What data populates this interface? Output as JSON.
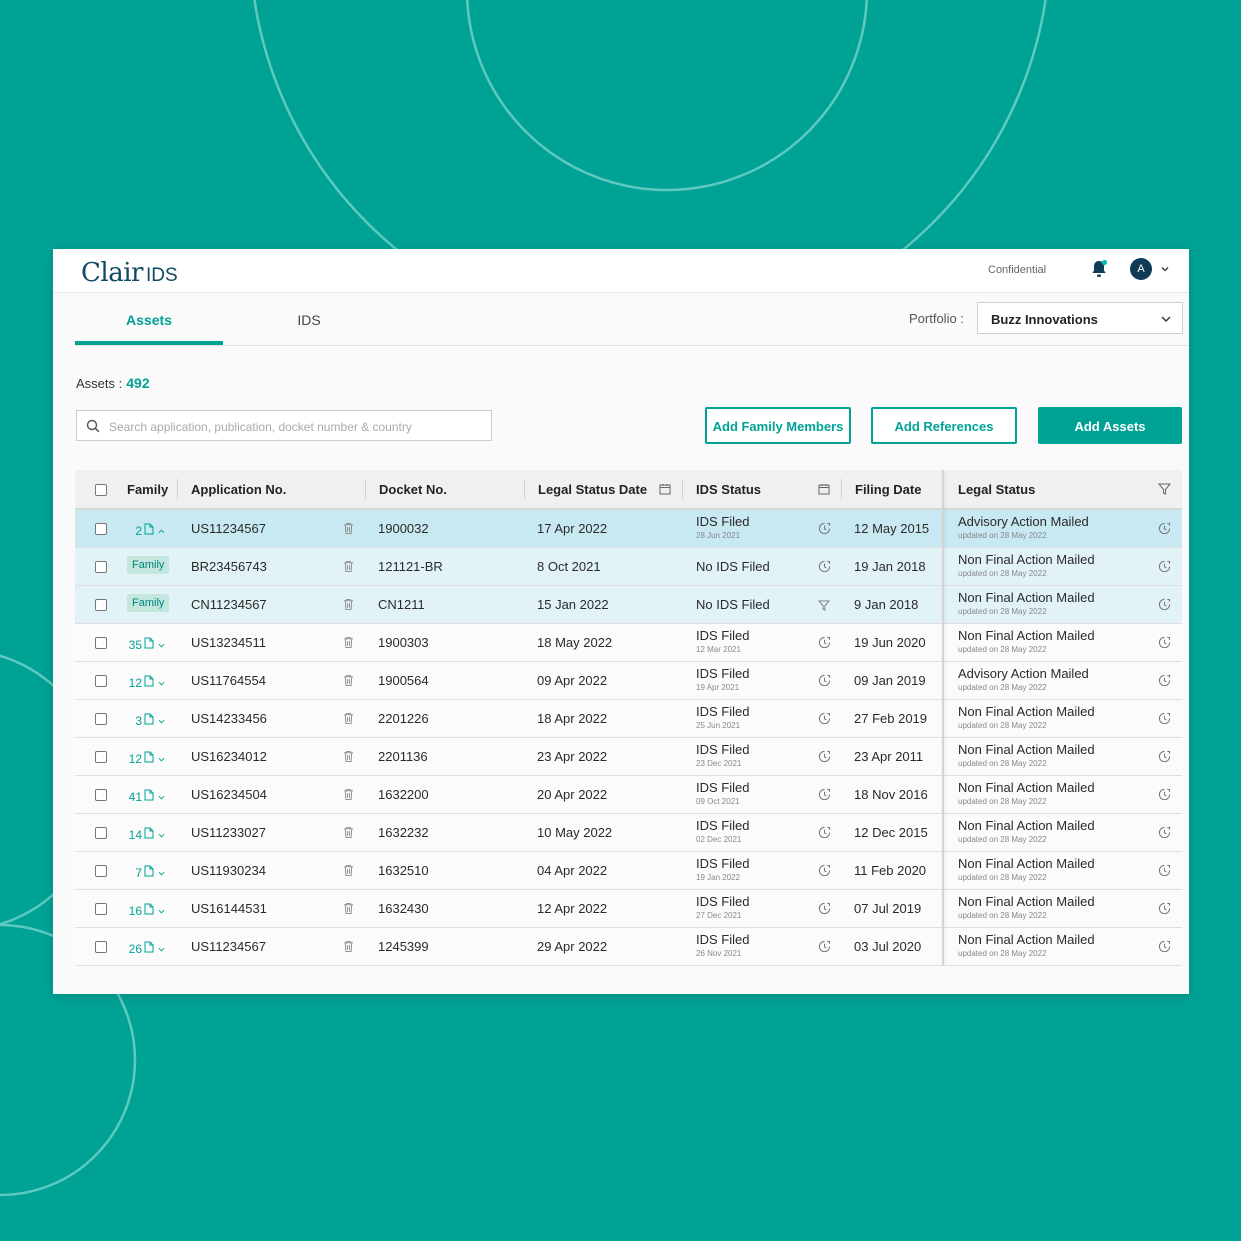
{
  "brand": {
    "name": "Clair",
    "product": "IDS"
  },
  "header": {
    "confidential": "Confidential",
    "avatar_initial": "A"
  },
  "tabs": [
    {
      "label": "Assets",
      "active": true
    },
    {
      "label": "IDS",
      "active": false
    }
  ],
  "portfolio": {
    "label": "Portfolio :",
    "value": "Buzz Innovations"
  },
  "assets": {
    "label": "Assets :",
    "count": "492"
  },
  "search": {
    "placeholder": "Search application, publication, docket number & country"
  },
  "actions": {
    "add_family": "Add Family Members",
    "add_references": "Add References",
    "add_assets": "Add Assets"
  },
  "columns": {
    "family": "Family",
    "application": "Application No.",
    "docket": "Docket No.",
    "legal_status_date": "Legal Status Date",
    "ids_status": "IDS Status",
    "filing_date": "Filing Date",
    "legal_status": "Legal Status"
  },
  "rows": [
    {
      "family": "2",
      "expanded": true,
      "state": "selected",
      "app": "US11234567",
      "docket": "1900032",
      "lsd": "17 Apr 2022",
      "ids": "IDS Filed",
      "ids_sub": "28 Jun 2021",
      "ids_icon": "clock-icon",
      "filing": "12 May 2015",
      "legal": "Advisory Action Mailed",
      "legal_sub": "updated on 28 May 2022"
    },
    {
      "family": "Family",
      "state": "child",
      "app": "BR23456743",
      "docket": "121121-BR",
      "lsd": "8 Oct 2021",
      "ids": "No IDS Filed",
      "ids_sub": "",
      "ids_icon": "clock-icon",
      "filing": "19 Jan 2018",
      "legal": "Non Final Action Mailed",
      "legal_sub": "updated on 28 May 2022"
    },
    {
      "family": "Family",
      "state": "child",
      "app": "CN11234567",
      "docket": "CN1211",
      "lsd": "15 Jan 2022",
      "ids": "No IDS Filed",
      "ids_sub": "",
      "ids_icon": "filter-icon",
      "filing": "9 Jan 2018",
      "legal": "Non Final Action Mailed",
      "legal_sub": "updated on 28 May 2022"
    },
    {
      "family": "35",
      "state": "normal",
      "app": "US13234511",
      "docket": "1900303",
      "lsd": "18 May 2022",
      "ids": "IDS Filed",
      "ids_sub": "12 Mar 2021",
      "ids_icon": "clock-icon",
      "filing": "19 Jun 2020",
      "legal": "Non Final Action Mailed",
      "legal_sub": "updated on 28 May 2022"
    },
    {
      "family": "12",
      "state": "normal",
      "app": "US11764554",
      "docket": "1900564",
      "lsd": "09 Apr 2022",
      "ids": "IDS Filed",
      "ids_sub": "19 Apr 2021",
      "ids_icon": "clock-icon",
      "filing": "09 Jan 2019",
      "legal": "Advisory Action Mailed",
      "legal_sub": "updated on 28 May 2022"
    },
    {
      "family": "3",
      "state": "normal",
      "app": "US14233456",
      "docket": "2201226",
      "lsd": "18 Apr 2022",
      "ids": "IDS Filed",
      "ids_sub": "25 Jun 2021",
      "ids_icon": "clock-icon",
      "filing": "27 Feb 2019",
      "legal": "Non Final Action Mailed",
      "legal_sub": "updated on 28 May 2022"
    },
    {
      "family": "12",
      "state": "normal",
      "app": "US16234012",
      "docket": "2201136",
      "lsd": "23 Apr 2022",
      "ids": "IDS Filed",
      "ids_sub": "23 Dec 2021",
      "ids_icon": "clock-icon",
      "filing": "23 Apr 2011",
      "legal": "Non Final Action Mailed",
      "legal_sub": "updated on 28 May 2022"
    },
    {
      "family": "41",
      "state": "normal",
      "app": "US16234504",
      "docket": "1632200",
      "lsd": "20 Apr 2022",
      "ids": "IDS Filed",
      "ids_sub": "09 Oct 2021",
      "ids_icon": "clock-icon",
      "filing": "18 Nov 2016",
      "legal": "Non Final Action Mailed",
      "legal_sub": "updated on 28 May 2022"
    },
    {
      "family": "14",
      "state": "normal",
      "app": "US11233027",
      "docket": "1632232",
      "lsd": "10 May 2022",
      "ids": "IDS Filed",
      "ids_sub": "02 Dec 2021",
      "ids_icon": "clock-icon",
      "filing": "12 Dec 2015",
      "legal": "Non Final Action Mailed",
      "legal_sub": "updated on 28 May 2022"
    },
    {
      "family": "7",
      "state": "normal",
      "app": "US11930234",
      "docket": "1632510",
      "lsd": "04 Apr 2022",
      "ids": "IDS Filed",
      "ids_sub": "19 Jan 2022",
      "ids_icon": "clock-icon",
      "filing": "11 Feb 2020",
      "legal": "Non Final Action Mailed",
      "legal_sub": "updated on 28 May 2022"
    },
    {
      "family": "16",
      "state": "normal",
      "app": "US16144531",
      "docket": "1632430",
      "lsd": "12 Apr 2022",
      "ids": "IDS Filed",
      "ids_sub": "27 Dec 2021",
      "ids_icon": "clock-icon",
      "filing": "07 Jul 2019",
      "legal": "Non Final Action Mailed",
      "legal_sub": "updated on 28 May 2022"
    },
    {
      "family": "26",
      "state": "normal",
      "app": "US11234567",
      "docket": "1245399",
      "lsd": "29 Apr 2022",
      "ids": "IDS Filed",
      "ids_sub": "26 Nov 2021",
      "ids_icon": "clock-icon",
      "filing": "03 Jul 2020",
      "legal": "Non Final Action Mailed",
      "legal_sub": "updated on 28 May 2022"
    }
  ],
  "colors": {
    "background": "#00a296",
    "accent": "#00a296",
    "selected_row": "#c8e9f1",
    "child_row": "#e2f3f8",
    "avatar": "#0f3b57"
  }
}
